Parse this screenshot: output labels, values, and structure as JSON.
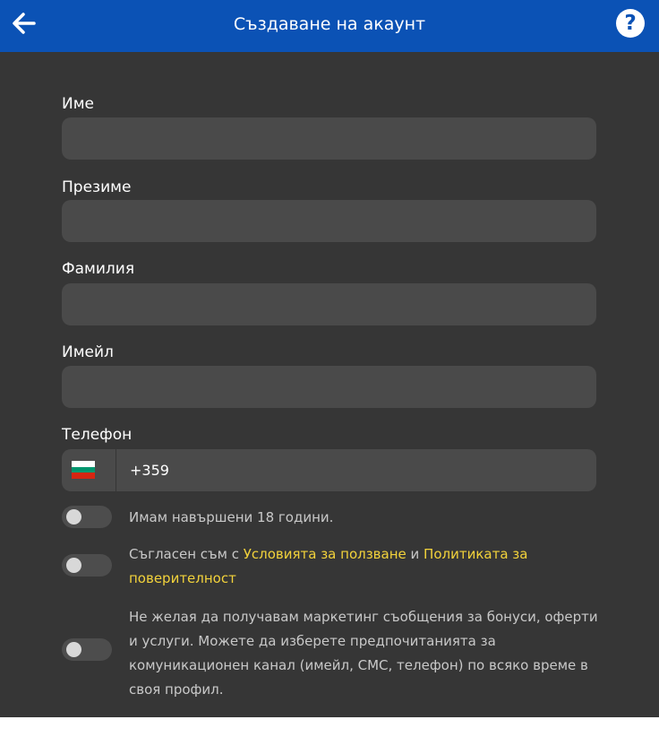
{
  "header": {
    "title": "Създаване на акаунт",
    "help_glyph": "?"
  },
  "form": {
    "first_name": {
      "label": "Име",
      "value": "",
      "placeholder": ""
    },
    "middle_name": {
      "label": "Презиме",
      "value": "",
      "placeholder": ""
    },
    "last_name": {
      "label": "Фамилия",
      "value": "",
      "placeholder": ""
    },
    "email": {
      "label": "Имейл",
      "value": "",
      "placeholder": ""
    },
    "phone": {
      "label": "Телефон",
      "value": "+359",
      "country_flag": "bulgaria-flag-icon"
    }
  },
  "consents": {
    "age": {
      "text": "Имам навършени 18 години.",
      "checked": false
    },
    "terms": {
      "prefix": "Съгласен съм с ",
      "link1": "Условията за ползване",
      "middle": " и ",
      "link2": "Политиката за поверителност",
      "checked": false
    },
    "marketing": {
      "text": "Не желая да получавам маркетинг съобщения за бонуси, оферти и услуги. Можете да изберете предпочитанията за комуникационен канал (имейл, СМС, телефон) по всяко време в своя профил.",
      "checked": false
    }
  },
  "colors": {
    "header_bg": "#0b52b5",
    "content_bg": "#363636",
    "input_bg": "#4a4a4a",
    "link": "#f2d23b",
    "flag_white": "#ffffff",
    "flag_green": "#00966e",
    "flag_red": "#d62612"
  }
}
